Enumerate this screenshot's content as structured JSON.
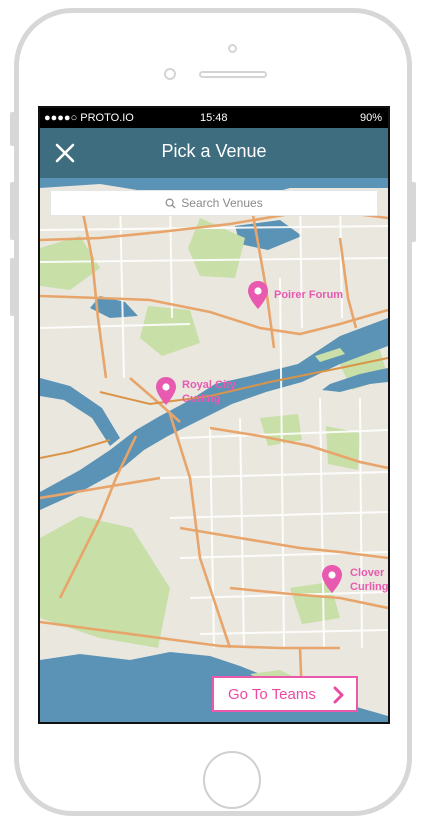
{
  "status_bar": {
    "signal": "●●●●○ PROTO.IO",
    "time": "15:48",
    "battery": "90%"
  },
  "header": {
    "title": "Pick a Venue",
    "close_icon": "close-icon"
  },
  "search": {
    "placeholder": "Search Venues",
    "icon": "search-icon"
  },
  "venues": [
    {
      "label": "Poirer Forum",
      "icon": "map-pin-icon"
    },
    {
      "label": "Royal City\nCurling",
      "icon": "map-pin-icon"
    },
    {
      "label": "Clover\nCurling",
      "icon": "map-pin-icon"
    }
  ],
  "footer": {
    "go_to_teams_label": "Go To Teams",
    "chevron_icon": "chevron-right-icon"
  },
  "colors": {
    "nav": "#3e6d80",
    "accent": "#ea4aa2",
    "water": "#5b93b6",
    "park": "#c8dfa8",
    "road": "#e8a56b"
  }
}
